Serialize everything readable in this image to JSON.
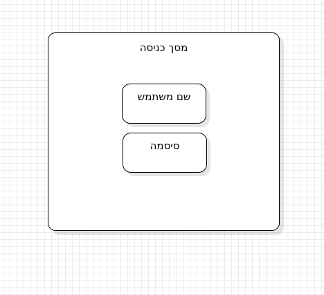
{
  "screen": {
    "title": "מסך כניסה"
  },
  "fields": {
    "username_label": "שם משתמש",
    "password_label": "סיסמה"
  }
}
